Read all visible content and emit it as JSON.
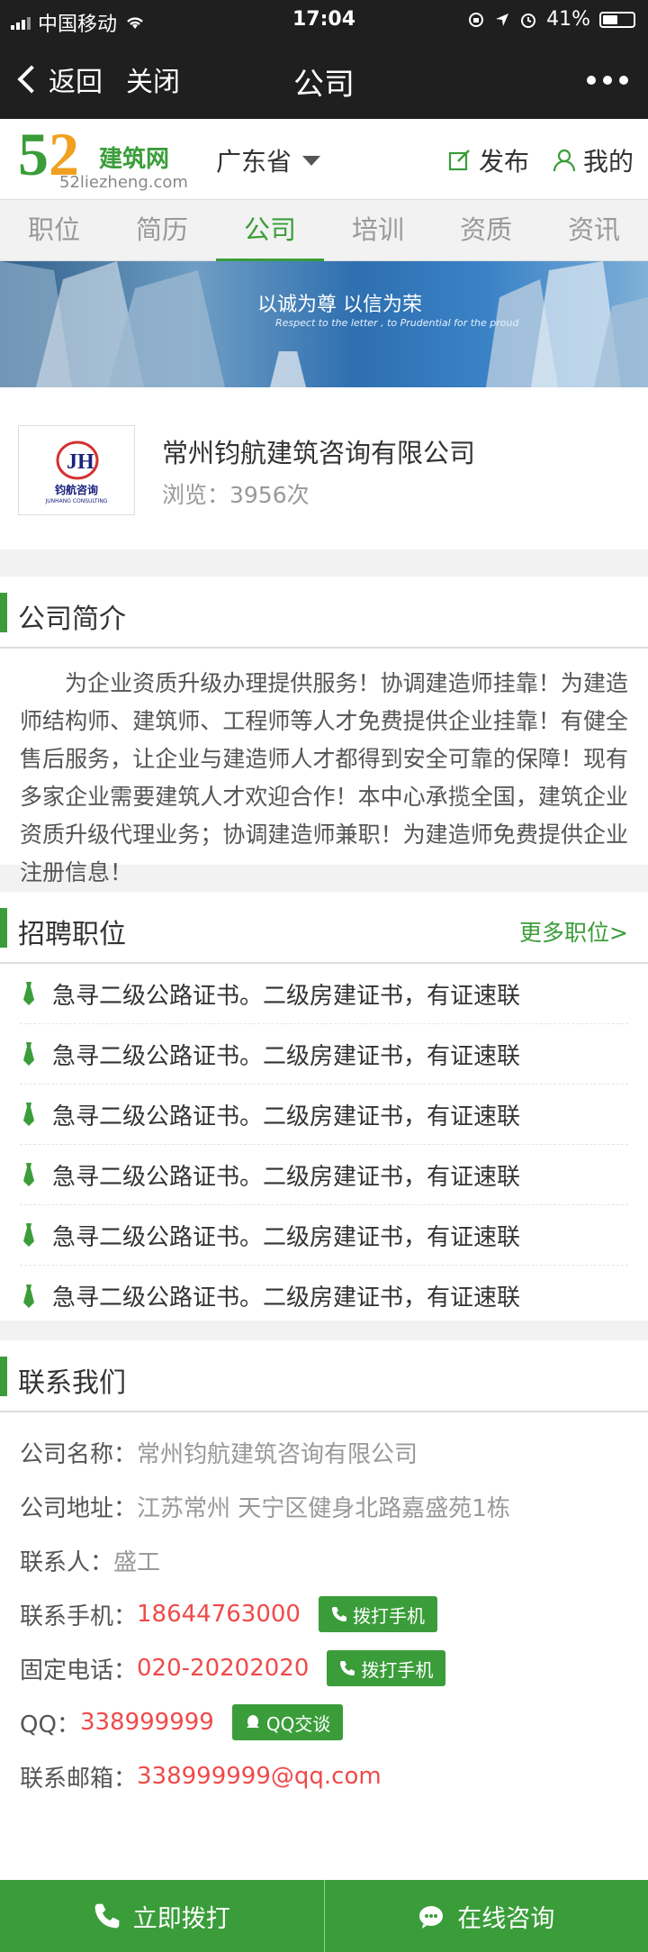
{
  "status_bar": {
    "carrier": "中国移动",
    "time": "17:04",
    "battery": "41%"
  },
  "nav_bar": {
    "back_label": "返回",
    "close_label": "关闭",
    "title": "公司"
  },
  "site_header": {
    "logo_brand": "建筑网",
    "logo_domain": "52liezheng.com",
    "logo_mark": "52",
    "province": "广东省",
    "publish_label": "发布",
    "mine_label": "我的"
  },
  "tabs": [
    {
      "label": "职位",
      "active": false
    },
    {
      "label": "简历",
      "active": false
    },
    {
      "label": "公司",
      "active": true
    },
    {
      "label": "培训",
      "active": false
    },
    {
      "label": "资质",
      "active": false
    },
    {
      "label": "资讯",
      "active": false
    }
  ],
  "banner": {
    "slogan": "以诚为尊  以信为荣",
    "subtitle": "Respect to the letter , to Prudential for the proud"
  },
  "company": {
    "name": "常州钧航建筑咨询有限公司",
    "views": "浏览：3956次",
    "logo_text": "钧航咨询",
    "logo_sub": "JUNHANG CONSULTING"
  },
  "intro": {
    "title": "公司简介",
    "text": "为企业资质升级办理提供服务！协调建造师挂靠！为建造师结构师、建筑师、工程师等人才免费提供企业挂靠！有健全售后服务，让企业与建造师人才都得到安全可靠的保障！现有多家企业需要建筑人才欢迎合作！本中心承揽全国，建筑企业资质升级代理业务；协调建造师兼职！为建造师免费提供企业注册信息！"
  },
  "jobs": {
    "title": "招聘职位",
    "more": "更多职位>",
    "items": [
      "急寻二级公路证书。二级房建证书，有证速联",
      "急寻二级公路证书。二级房建证书，有证速联",
      "急寻二级公路证书。二级房建证书，有证速联",
      "急寻二级公路证书。二级房建证书，有证速联",
      "急寻二级公路证书。二级房建证书，有证速联",
      "急寻二级公路证书。二级房建证书，有证速联"
    ]
  },
  "contact": {
    "title": "联系我们",
    "company_label": "公司名称：",
    "company_value": "常州钧航建筑咨询有限公司",
    "address_label": "公司地址：",
    "address_value": "江苏常州 天宁区健身北路嘉盛苑1栋",
    "person_label": "联系人：",
    "person_value": "盛工",
    "mobile_label": "联系手机：",
    "mobile_value": "18644763000",
    "mobile_btn": "拨打手机",
    "phone_label": "固定电话：",
    "phone_value": "020-20202020",
    "phone_btn": "拨打手机",
    "qq_label": "QQ：",
    "qq_value": "338999999",
    "qq_btn": "QQ交谈",
    "email_label": "联系邮箱：",
    "email_value": "338999999@qq.com"
  },
  "bottom": {
    "call_label": "立即拨打",
    "consult_label": "在线咨询"
  },
  "colors": {
    "accent": "#3a9d3a",
    "highlight": "#f04a4a",
    "dark": "#1f1f1f"
  }
}
